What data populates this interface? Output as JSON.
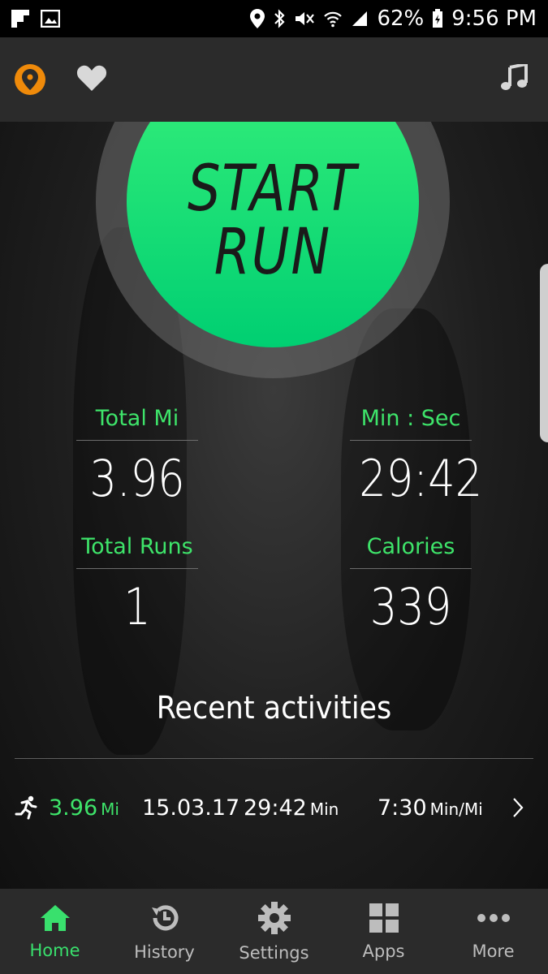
{
  "status_bar": {
    "battery": "62%",
    "time": "9:56 PM",
    "icons": [
      "flipboard-icon",
      "image-icon",
      "location-icon",
      "bluetooth-icon",
      "mute-icon",
      "wifi-icon",
      "signal-icon",
      "battery-icon"
    ]
  },
  "header": {
    "icons": [
      "location-pin-icon",
      "heart-icon",
      "music-note-icon"
    ],
    "accent": "#ef8a0a"
  },
  "start_button": {
    "line1": "START",
    "line2": "RUN",
    "color": "#1ee676"
  },
  "stats": {
    "total_mi": {
      "label": "Total Mi",
      "value": "3.96"
    },
    "min_sec": {
      "label": "Min : Sec",
      "value": "29:42"
    },
    "total_runs": {
      "label": "Total Runs",
      "value": "1"
    },
    "calories": {
      "label": "Calories",
      "value": "339"
    }
  },
  "recent": {
    "title": "Recent activities",
    "items": [
      {
        "distance": "3.96",
        "distance_unit": "Mi",
        "date": "15.03.17",
        "duration": "29:42",
        "duration_unit": "Min",
        "pace": "7:30",
        "pace_unit": "Min/Mi"
      }
    ]
  },
  "nav": {
    "items": [
      {
        "label": "Home",
        "icon": "home-icon",
        "active": true
      },
      {
        "label": "History",
        "icon": "history-icon",
        "active": false
      },
      {
        "label": "Settings",
        "icon": "gear-icon",
        "active": false
      },
      {
        "label": "Apps",
        "icon": "apps-grid-icon",
        "active": false
      },
      {
        "label": "More",
        "icon": "more-dots-icon",
        "active": false
      }
    ]
  },
  "colors": {
    "accent_green": "#3ee46a",
    "bar_bg": "#2b2b2b"
  }
}
